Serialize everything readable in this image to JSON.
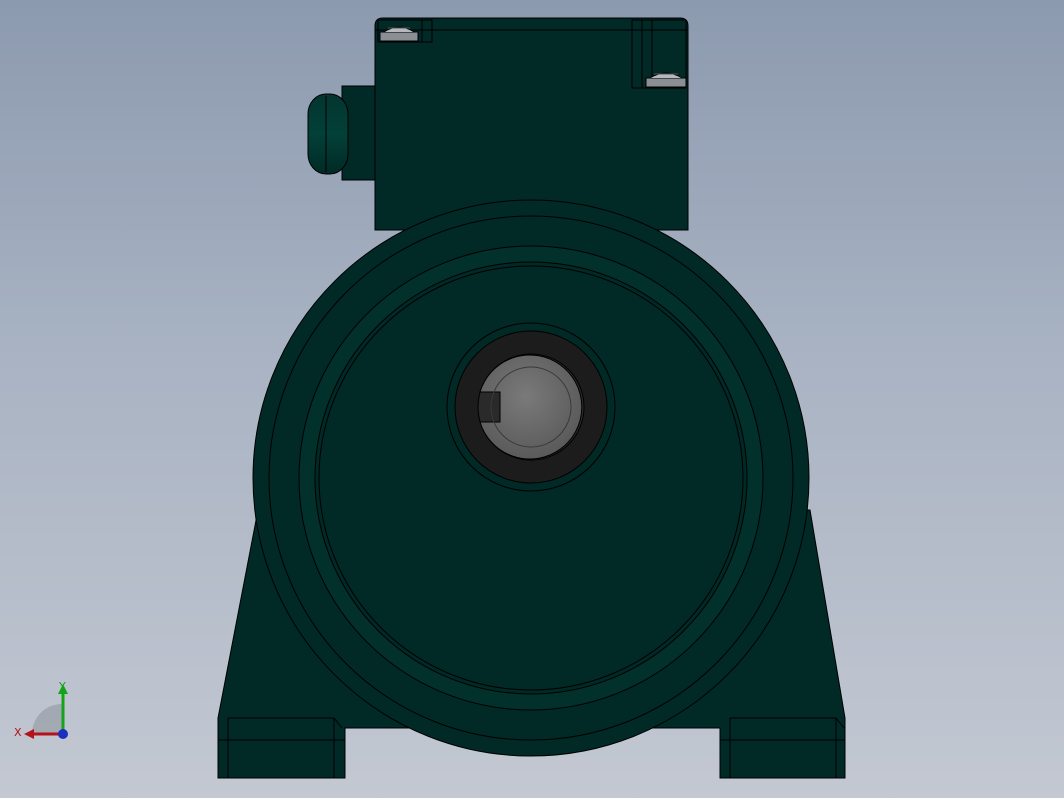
{
  "view": {
    "type": "3d-cad-viewport",
    "background": {
      "top": "#8c9aaf",
      "bottom": "#c3c8d2"
    }
  },
  "model": {
    "name": "electric-motor",
    "body_color": "#012a26",
    "edge_color": "#000000",
    "shaft_color": "#6a6a6a",
    "bearing_color": "#1c1c1c",
    "screw_color": "#8a8f96"
  },
  "triad": {
    "x_label": "X",
    "y_label": "Y",
    "x_color": "#b3121a",
    "y_color": "#14a31a",
    "z_color": "#1a2fbf"
  }
}
